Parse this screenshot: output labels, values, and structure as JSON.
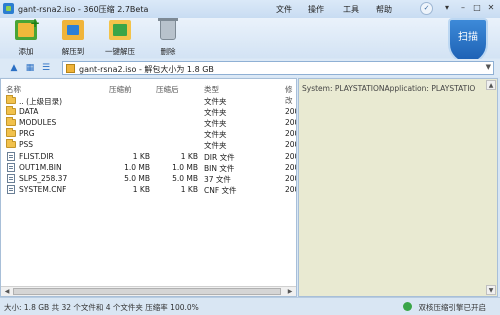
{
  "window": {
    "title": "gant-rsna2.iso - 360压缩 2.7Beta"
  },
  "menu": {
    "file": "文件",
    "operate": "操作",
    "tools": "工具",
    "help": "帮助"
  },
  "toolbar": {
    "add": "添加",
    "extract_to": "解压到",
    "one_click": "一键解压",
    "delete": "删除"
  },
  "scan": {
    "label": "扫描"
  },
  "address": {
    "path": "gant-rsna2.iso - 解包大小为 1.8 GB"
  },
  "columns": {
    "name": "名称",
    "size": "压缩前",
    "csize": "压缩后",
    "type": "类型",
    "modified": "修改"
  },
  "rows": [
    {
      "name": ".. (上级目录)",
      "size": "",
      "csize": "",
      "type": "文件夹",
      "mod": ""
    },
    {
      "name": "DATA",
      "size": "",
      "csize": "",
      "type": "文件夹",
      "mod": "200"
    },
    {
      "name": "MODULES",
      "size": "",
      "csize": "",
      "type": "文件夹",
      "mod": "200"
    },
    {
      "name": "PRG",
      "size": "",
      "csize": "",
      "type": "文件夹",
      "mod": "200"
    },
    {
      "name": "PSS",
      "size": "",
      "csize": "",
      "type": "文件夹",
      "mod": "200"
    },
    {
      "name": "FLIST.DIR",
      "size": "1 KB",
      "csize": "1 KB",
      "type": "DIR 文件",
      "mod": "200"
    },
    {
      "name": "OUT1M.BIN",
      "size": "1.0 MB",
      "csize": "1.0 MB",
      "type": "BIN 文件",
      "mod": "200"
    },
    {
      "name": "SLPS_258.37",
      "size": "5.0 MB",
      "csize": "5.0 MB",
      "type": "37 文件",
      "mod": "200"
    },
    {
      "name": "SYSTEM.CNF",
      "size": "1 KB",
      "csize": "1 KB",
      "type": "CNF 文件",
      "mod": "200"
    }
  ],
  "info": {
    "text": "System: PLAYSTATIONApplication: PLAYSTATIO"
  },
  "status": {
    "text": "大小: 1.8 GB 共 32 个文件和 4 个文件夹 压缩率 100.0%",
    "right": "双核压缩引擎已开启"
  }
}
